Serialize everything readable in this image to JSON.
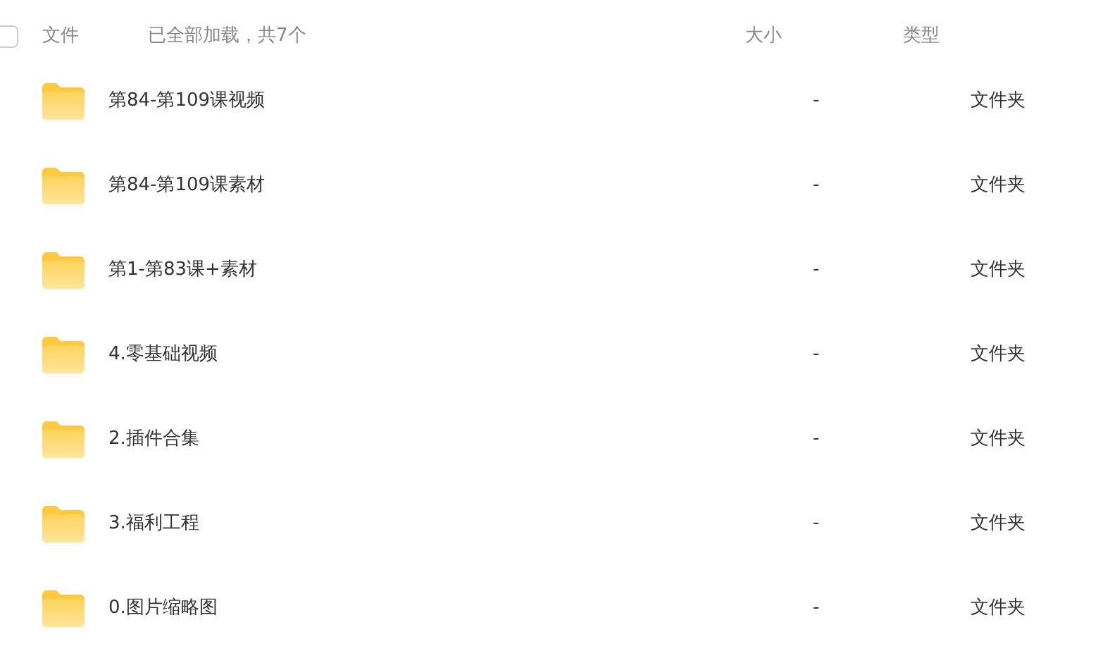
{
  "header": {
    "select_all": {
      "checked": false
    },
    "name_label": "文件",
    "status": "已全部加载，共7个",
    "size_label": "大小",
    "type_label": "类型"
  },
  "files": [
    {
      "name": "第84-第109课视频",
      "size": "-",
      "type": "文件夹",
      "selected": false
    },
    {
      "name": "第84-第109课素材",
      "size": "-",
      "type": "文件夹",
      "selected": false
    },
    {
      "name": "第1-第83课+素材",
      "size": "-",
      "type": "文件夹",
      "selected": false
    },
    {
      "name": "4.零基础视频",
      "size": "-",
      "type": "文件夹",
      "selected": false
    },
    {
      "name": "2.插件合集",
      "size": "-",
      "type": "文件夹",
      "selected": false
    },
    {
      "name": "3.福利工程",
      "size": "-",
      "type": "文件夹",
      "selected": false
    },
    {
      "name": "0.图片缩略图",
      "size": "-",
      "type": "文件夹",
      "selected": false
    }
  ]
}
